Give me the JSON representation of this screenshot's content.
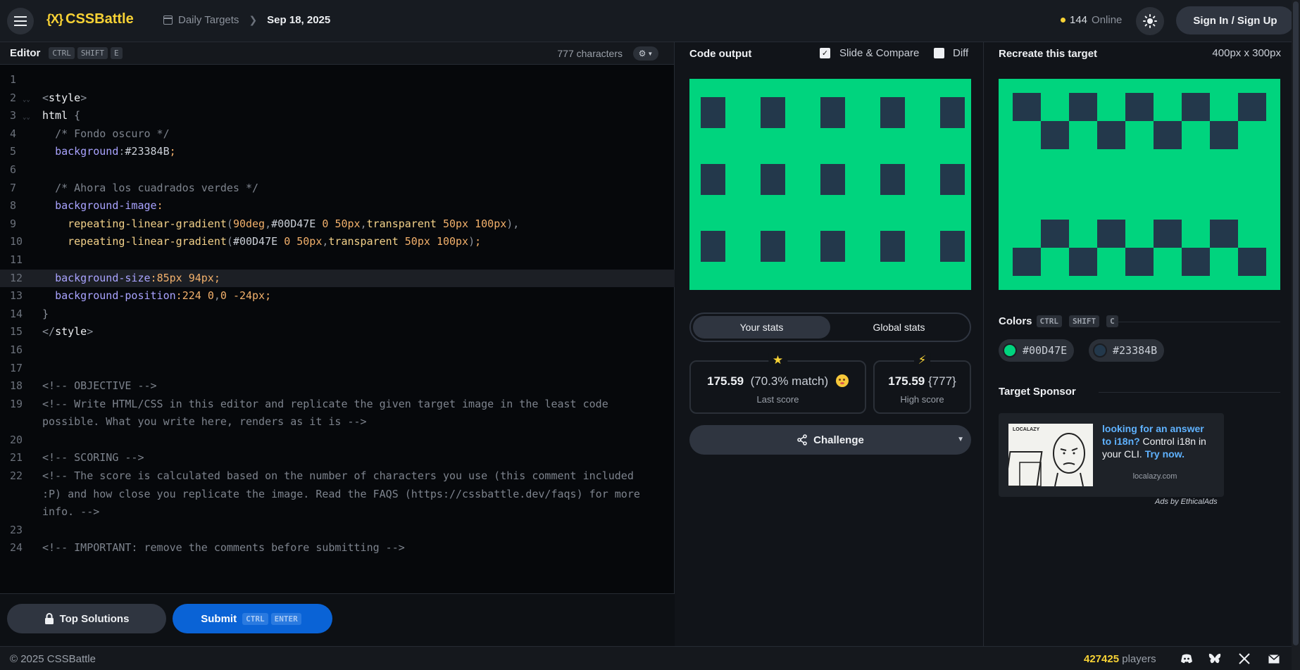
{
  "header": {
    "logo_mark": "{X}",
    "logo_text": "CSSBattle",
    "breadcrumb_section": "Daily Targets",
    "breadcrumb_date": "Sep 18, 2025",
    "online_count": "144",
    "online_label": "Online",
    "signin_label": "Sign In / Sign Up"
  },
  "editor": {
    "title": "Editor",
    "shortcut": [
      "CTRL",
      "SHIFT",
      "E"
    ],
    "char_count": "777 characters",
    "lines": [
      {
        "n": "1",
        "text": ""
      },
      {
        "n": "2",
        "text": "<style>"
      },
      {
        "n": "3",
        "text": "html {"
      },
      {
        "n": "4",
        "text": "  /* Fondo oscuro */"
      },
      {
        "n": "5",
        "text": "  background:#23384B;"
      },
      {
        "n": "6",
        "text": ""
      },
      {
        "n": "7",
        "text": "  /* Ahora los cuadrados verdes */"
      },
      {
        "n": "8",
        "text": "  background-image:"
      },
      {
        "n": "9",
        "text": "    repeating-linear-gradient(90deg,#00D47E 0 50px,transparent 50px 100px),"
      },
      {
        "n": "10",
        "text": "    repeating-linear-gradient(#00D47E 0 50px,transparent 50px 100px);"
      },
      {
        "n": "11",
        "text": ""
      },
      {
        "n": "12",
        "text": "  background-size:85px 94px;"
      },
      {
        "n": "13",
        "text": "  background-position:224 0,0 -24px;"
      },
      {
        "n": "14",
        "text": "}"
      },
      {
        "n": "15",
        "text": "</style>"
      },
      {
        "n": "16",
        "text": ""
      },
      {
        "n": "17",
        "text": ""
      },
      {
        "n": "18",
        "text": "<!-- OBJECTIVE -->"
      },
      {
        "n": "19",
        "text": "<!-- Write HTML/CSS in this editor and replicate the given target image in the least code possible. What you write here, renders as it is -->"
      },
      {
        "n": "20",
        "text": ""
      },
      {
        "n": "21",
        "text": "<!-- SCORING -->"
      },
      {
        "n": "22",
        "text": "<!-- The score is calculated based on the number of characters you use (this comment included :P) and how close you replicate the image. Read the FAQS (https://cssbattle.dev/faqs) for more info. -->"
      },
      {
        "n": "23",
        "text": ""
      },
      {
        "n": "24",
        "text": "<!-- IMPORTANT: remove the comments before submitting -->"
      }
    ],
    "top_solutions_label": "Top Solutions",
    "submit_label": "Submit",
    "submit_shortcut": [
      "CTRL",
      "ENTER"
    ]
  },
  "output": {
    "title": "Code output",
    "slide_compare_label": "Slide & Compare",
    "diff_label": "Diff",
    "tab_your_stats": "Your stats",
    "tab_global_stats": "Global stats",
    "last_score_value": "175.59",
    "last_score_match": "(70.3% match)",
    "last_score_caption": "Last score",
    "high_score_value": "175.59",
    "high_score_chars": "{777}",
    "high_score_caption": "High score",
    "challenge_label": "Challenge"
  },
  "target": {
    "title": "Recreate this target",
    "dimensions": "400px x 300px",
    "colors_title": "Colors",
    "colors_shortcut": [
      "CTRL",
      "SHIFT",
      "C"
    ],
    "colors": [
      {
        "hex": "#00D47E"
      },
      {
        "hex": "#23384B"
      }
    ],
    "sponsor_title": "Target Sponsor",
    "ad_brand": "LOCALAZY",
    "ad_headline": "looking for an answer to i18n?",
    "ad_body": " Control i18n in your CLI. ",
    "ad_cta": "Try now.",
    "ad_domain": "localazy.com",
    "ads_by": "Ads by EthicalAds"
  },
  "footer": {
    "copyright": "© 2025 CSSBattle",
    "players_count": "427425",
    "players_label": "players",
    "social_icons": [
      "discord-icon",
      "bluesky-icon",
      "x-icon",
      "mail-icon"
    ]
  },
  "theme": {
    "accent": "#f7d235",
    "primary_button": "#0a63d6",
    "target_green": "#00D47E",
    "target_dark": "#23384B"
  }
}
